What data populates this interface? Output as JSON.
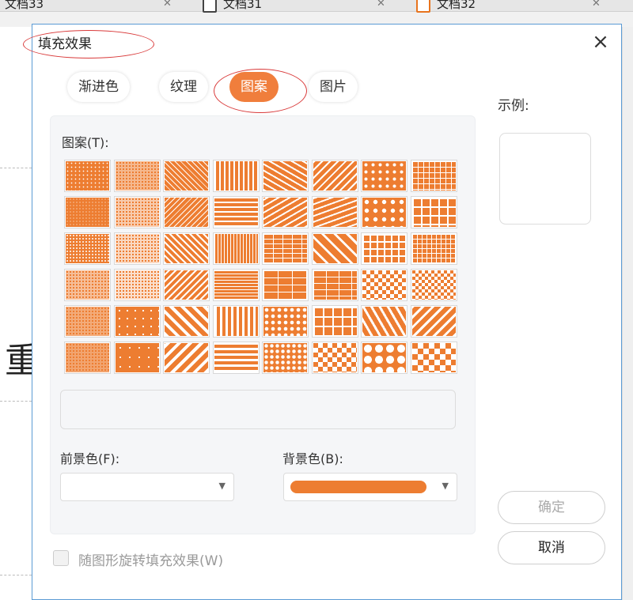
{
  "app": {
    "tabs": [
      {
        "label": "文档33"
      },
      {
        "label": "文档31"
      },
      {
        "label": "文档32"
      }
    ],
    "background_char": "重"
  },
  "dialog": {
    "title": "填充效果",
    "close_label": "×",
    "tabs": [
      {
        "label": "渐进色",
        "active": false
      },
      {
        "label": "纹理",
        "active": false
      },
      {
        "label": "图案",
        "active": true
      },
      {
        "label": "图片",
        "active": false
      }
    ],
    "pattern_label": "图案(T):",
    "foreground_label": "前景色(F):",
    "background_label": "背景色(B):",
    "example_label": "示例:",
    "ok_label": "确定",
    "cancel_label": "取消",
    "rotate_label": "随图形旋转填充效果(W)",
    "rotate_checked": false,
    "colors": {
      "foreground": "#ffffff",
      "background": "#ed7d31",
      "accent": "#f07e3c",
      "annotation": "#d93a3a"
    },
    "pattern_icons": [
      "percent-5",
      "percent-10",
      "light-downward-diagonal",
      "light-vertical",
      "dashed-downward-diagonal",
      "zigzag",
      "small-confetti",
      "small-grid",
      "percent-20",
      "percent-25",
      "light-upward-diagonal",
      "light-horizontal",
      "dashed-upward-diagonal",
      "wave",
      "large-confetti",
      "large-grid",
      "percent-30",
      "percent-40",
      "dark-downward-diagonal",
      "narrow-vertical",
      "small-brick",
      "diagonal-brick",
      "dotted-grid",
      "dotted-diamond",
      "percent-50",
      "percent-60",
      "dark-upward-diagonal",
      "narrow-horizontal",
      "large-brick",
      "horizontal-brick",
      "weave",
      "small-checkerboard",
      "percent-70",
      "percent-75",
      "wide-downward-diagonal",
      "dark-vertical",
      "divot",
      "plaid",
      "shingle",
      "trellis",
      "percent-80",
      "percent-90",
      "wide-upward-diagonal",
      "dark-horizontal",
      "sphere",
      "outlined-diamond",
      "solid-diamond",
      "large-checkerboard"
    ]
  }
}
